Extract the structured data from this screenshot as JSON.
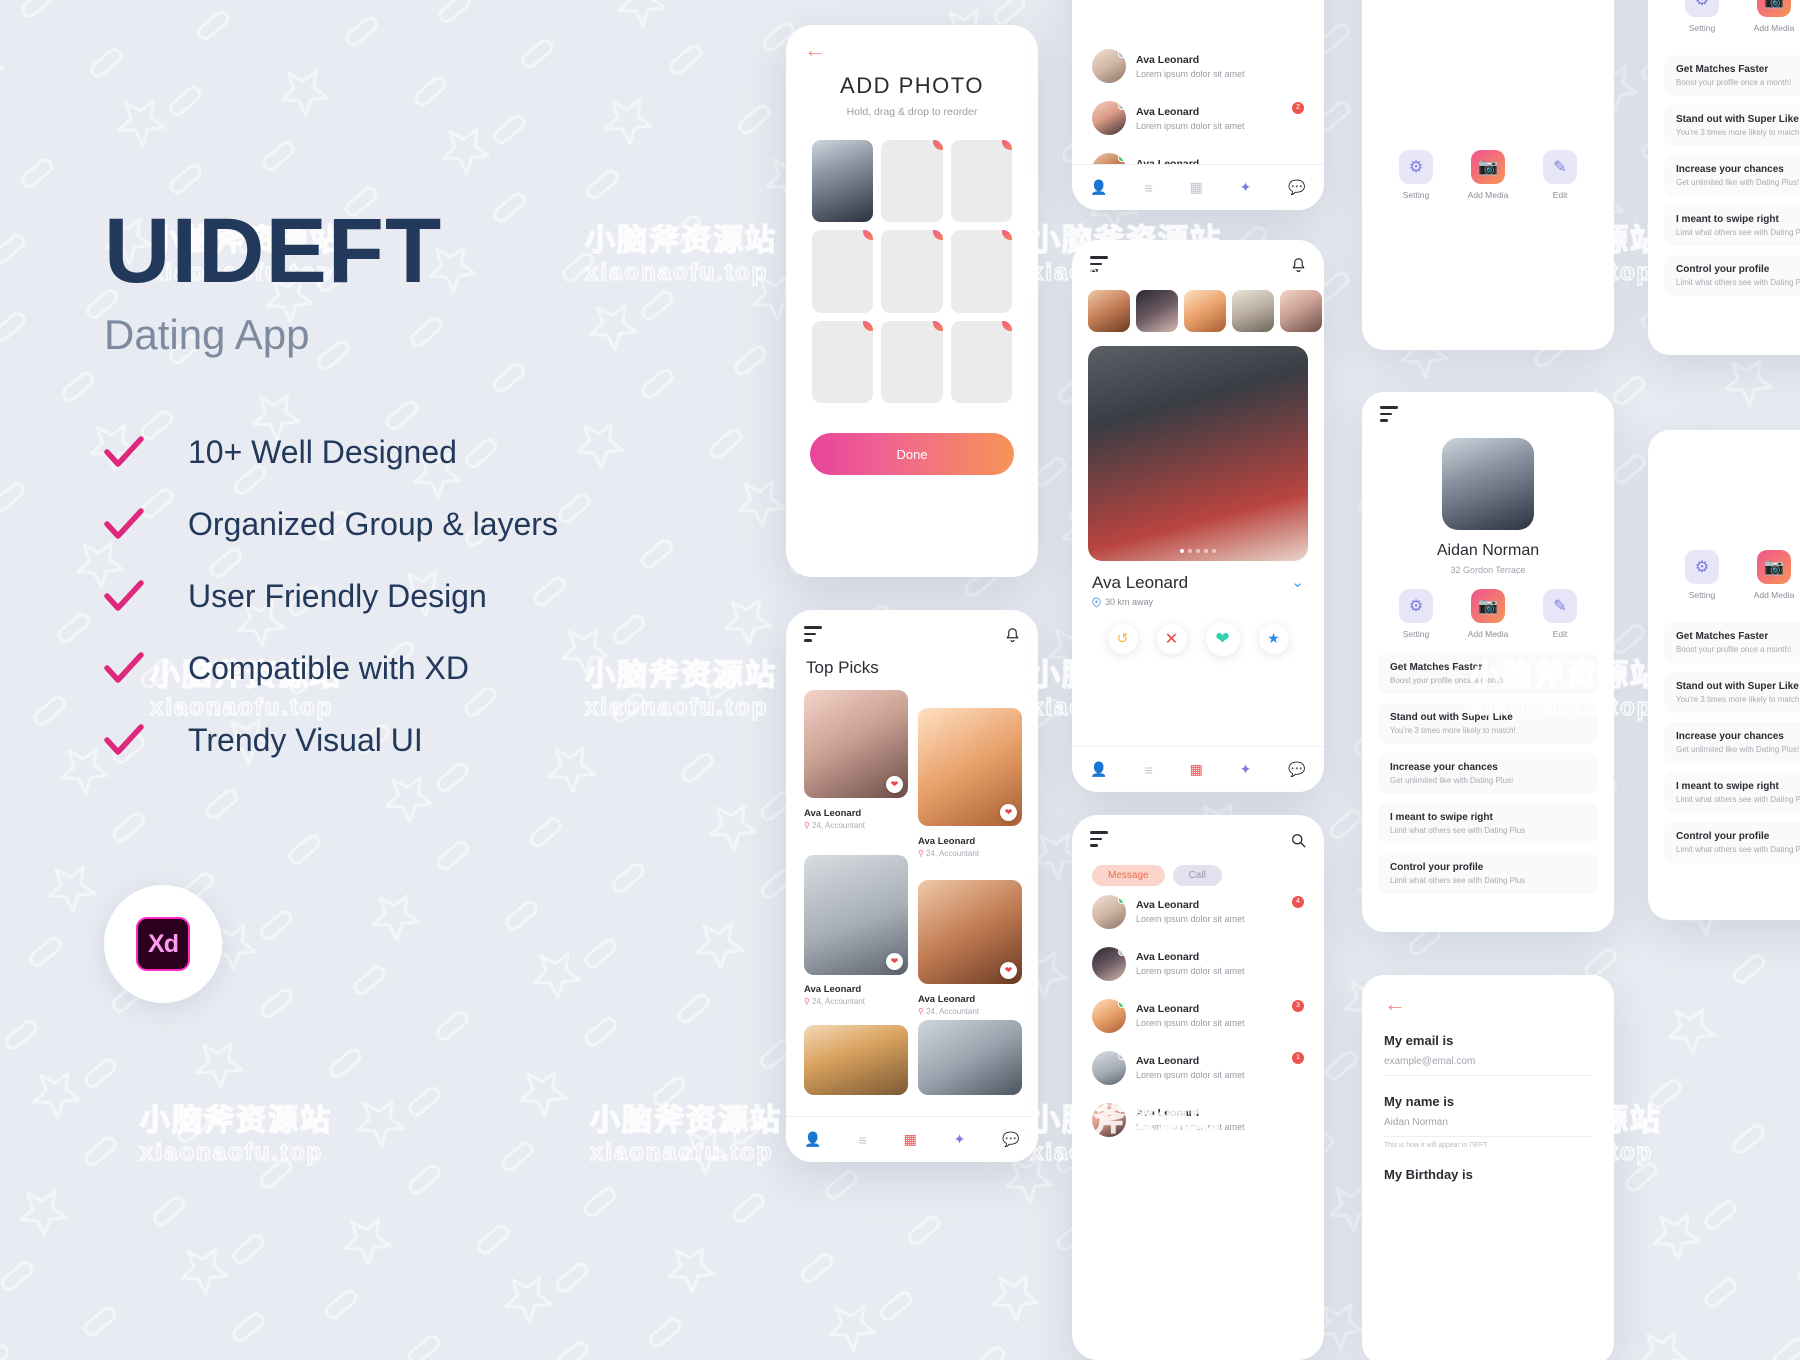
{
  "hero": {
    "title": "UIDEFT",
    "subtitle": "Dating App",
    "features": [
      "10+ Well Designed",
      "Organized Group & layers",
      "User Friendly Design",
      "Compatible with XD",
      "Trendy Visual UI"
    ],
    "badge_label": "Xd"
  },
  "colors": {
    "accent_pink": "#e8449b",
    "accent_orange": "#f79457",
    "title_navy": "#23395b",
    "check_magenta": "#e0267d",
    "background": "#e8ebf1"
  },
  "add_photo": {
    "back_icon": "back-arrow-icon",
    "title": "ADD PHOTO",
    "subtitle": "Hold, drag & drop to reorder",
    "plus_label": "+",
    "done_label": "Done",
    "cells": [
      {
        "filled": true
      },
      {
        "filled": false
      },
      {
        "filled": false
      },
      {
        "filled": false
      },
      {
        "filled": false
      },
      {
        "filled": false
      },
      {
        "filled": false
      },
      {
        "filled": false
      },
      {
        "filled": false
      }
    ]
  },
  "top_picks": {
    "title": "Top Picks",
    "menu_icon": "hamburger-icon",
    "bell_icon": "bell-icon",
    "cards": [
      {
        "name": "Ava Leonard",
        "age": "24,",
        "job": "Accountant"
      },
      {
        "name": "Ava Leonard",
        "age": "24,",
        "job": "Accountant"
      },
      {
        "name": "Ava Leonard",
        "age": "24,",
        "job": "Accountant"
      },
      {
        "name": "Ava Leonard",
        "age": "24,",
        "job": "Accountant"
      }
    ]
  },
  "swipe": {
    "menu_icon": "hamburger-icon",
    "bell_icon": "bell-icon",
    "name": "Ava Leonard",
    "distance": "30 km away",
    "chevron": "chevron-down-icon",
    "actions": [
      "undo-icon",
      "close-icon",
      "heart-icon",
      "star-icon"
    ]
  },
  "chat": {
    "menu_icon": "hamburger-icon",
    "search_icon": "search-icon",
    "tab_message": "Message",
    "tab_call": "Call",
    "rows": [
      {
        "name": "Ava Leonard",
        "preview": "Lorem ipsum dolor sit amet",
        "badge": "4",
        "status": "online"
      },
      {
        "name": "Ava Leonard",
        "preview": "Lorem ipsum dolor sit amet",
        "badge": "",
        "status": "offline"
      },
      {
        "name": "Ava Leonard",
        "preview": "Lorem ipsum dolor sit amet",
        "badge": "3",
        "status": "online"
      },
      {
        "name": "Ava Leonard",
        "preview": "Lorem ipsum dolor sit amet",
        "badge": "1",
        "status": "offline"
      },
      {
        "name": "Ava Leonard",
        "preview": "Lorem ipsum dolor sit amet",
        "badge": "",
        "status": "offline"
      }
    ]
  },
  "chat_top": {
    "rows": [
      {
        "name": "Ava Leonard",
        "preview": "Lorem ipsum dolor sit amet",
        "badge": "",
        "status": "offline"
      },
      {
        "name": "Ava Leonard",
        "preview": "Lorem ipsum dolor sit amet",
        "badge": "2",
        "status": "offline"
      },
      {
        "name": "Ava Leonard",
        "preview": "Lorem ipsum dolor sit amet",
        "badge": "",
        "status": "online"
      }
    ]
  },
  "profile": {
    "menu_icon": "hamburger-icon",
    "name": "Aidan Norman",
    "address": "32 Gordon Terrace",
    "actions": [
      {
        "label": "Setting",
        "icon": "gear-icon"
      },
      {
        "label": "Add Media",
        "icon": "camera-icon"
      },
      {
        "label": "Edit",
        "icon": "pencil-icon"
      }
    ]
  },
  "settings_cards": [
    {
      "title": "Get Matches Faster",
      "sub": "Boost your profile once a month!"
    },
    {
      "title": "Stand out with Super Like",
      "sub": "You're 3 times more likely to match!"
    },
    {
      "title": "Increase your chances",
      "sub": "Get unlimited like with Dating Plus!"
    },
    {
      "title": "I meant to swipe right",
      "sub": "Limit what others see with Dating Plus"
    },
    {
      "title": "Control your profile",
      "sub": "Limit what others see with Dating Plus"
    }
  ],
  "form": {
    "back_icon": "back-arrow-icon",
    "fields": [
      {
        "label": "My email is",
        "value": "example@emal.com",
        "hint": ""
      },
      {
        "label": "My name is",
        "value": "Aidan Norman",
        "hint": "This is how it will appear in DEFT"
      },
      {
        "label": "My Birthday is",
        "value": "",
        "hint": ""
      }
    ]
  },
  "watermark": {
    "cn": "小脑斧资源站",
    "en": "xiaonaofu.top"
  }
}
